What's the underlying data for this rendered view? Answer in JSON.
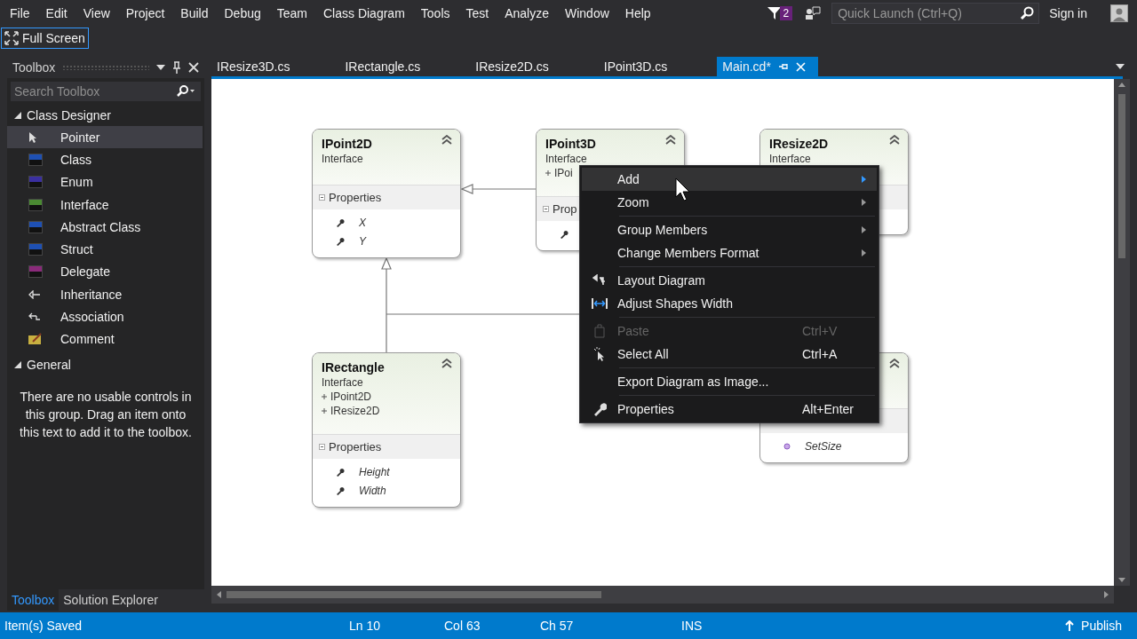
{
  "menu_bar": [
    "File",
    "Edit",
    "View",
    "Project",
    "Build",
    "Debug",
    "Team",
    "Class Diagram",
    "Tools",
    "Test",
    "Analyze",
    "Window",
    "Help"
  ],
  "notifications": {
    "count": "2"
  },
  "quick_launch": {
    "placeholder": "Quick Launch (Ctrl+Q)"
  },
  "sign_in": "Sign in",
  "toolbar": {
    "full_screen": "Full Screen"
  },
  "toolbox": {
    "title": "Toolbox",
    "search_placeholder": "Search Toolbox",
    "groups": [
      {
        "name": "Class Designer",
        "expanded": true,
        "items": [
          {
            "label": "Pointer",
            "kind": "pointer",
            "selected": true
          },
          {
            "label": "Class",
            "kind": "class",
            "selected": false
          },
          {
            "label": "Enum",
            "kind": "enum",
            "selected": false
          },
          {
            "label": "Interface",
            "kind": "interface",
            "selected": false
          },
          {
            "label": "Abstract Class",
            "kind": "abstract",
            "selected": false
          },
          {
            "label": "Struct",
            "kind": "struct",
            "selected": false
          },
          {
            "label": "Delegate",
            "kind": "delegate",
            "selected": false
          },
          {
            "label": "Inheritance",
            "kind": "inheritance",
            "selected": false
          },
          {
            "label": "Association",
            "kind": "association",
            "selected": false
          },
          {
            "label": "Comment",
            "kind": "comment",
            "selected": false
          }
        ]
      },
      {
        "name": "General",
        "expanded": true,
        "message": "There are no usable controls in this group. Drag an item onto this text to add it to the toolbox."
      }
    ]
  },
  "panel_tabs": [
    {
      "label": "Toolbox",
      "selected": true
    },
    {
      "label": "Solution Explorer",
      "selected": false
    }
  ],
  "document_tabs": [
    {
      "label": "IResize3D.cs",
      "selected": false
    },
    {
      "label": "IRectangle.cs",
      "selected": false
    },
    {
      "label": "IResize2D.cs",
      "selected": false
    },
    {
      "label": "IPoint3D.cs",
      "selected": false
    },
    {
      "label": "Main.cd*",
      "selected": true
    }
  ],
  "diagram": {
    "shapes": [
      {
        "title": "IPoint2D",
        "stereotype": "Interface",
        "compartment": "Properties",
        "members": [
          {
            "kind": "property",
            "name": "X"
          },
          {
            "kind": "property",
            "name": "Y"
          }
        ]
      },
      {
        "title": "IPoint3D",
        "stereotype": "Interface",
        "bases": [
          "IPoi"
        ],
        "compartment": "Prop",
        "members": [
          {
            "kind": "property"
          }
        ]
      },
      {
        "title": "IResize2D",
        "stereotype": "Interface"
      },
      {
        "title": "IRectangle",
        "stereotype": "Interface",
        "bases": [
          "IPoint2D",
          "IResize2D"
        ],
        "compartment": "Properties",
        "members": [
          {
            "kind": "property",
            "name": "Height"
          },
          {
            "kind": "property",
            "name": "Width"
          }
        ]
      },
      {
        "members": [
          {
            "kind": "method",
            "name": "SetSize"
          }
        ]
      }
    ]
  },
  "context_menu": [
    {
      "kind": "submenu",
      "label": "Add",
      "highlighted": true,
      "disabled": false
    },
    {
      "kind": "submenu",
      "label": "Zoom",
      "highlighted": false,
      "disabled": false
    },
    {
      "kind": "separator"
    },
    {
      "kind": "submenu",
      "label": "Group Members",
      "highlighted": false,
      "disabled": false
    },
    {
      "kind": "submenu",
      "label": "Change Members Format",
      "highlighted": false,
      "disabled": false
    },
    {
      "kind": "separator"
    },
    {
      "kind": "item",
      "label": "Layout Diagram",
      "highlighted": false,
      "disabled": false
    },
    {
      "kind": "item",
      "label": "Adjust Shapes Width",
      "highlighted": false,
      "disabled": false
    },
    {
      "kind": "separator"
    },
    {
      "kind": "item",
      "label": "Paste",
      "shortcut": "Ctrl+V",
      "highlighted": false,
      "disabled": true
    },
    {
      "kind": "item",
      "label": "Select All",
      "shortcut": "Ctrl+A",
      "highlighted": false,
      "disabled": false
    },
    {
      "kind": "separator"
    },
    {
      "kind": "item",
      "label": "Export Diagram as Image...",
      "highlighted": false,
      "disabled": false
    },
    {
      "kind": "separator"
    },
    {
      "kind": "item",
      "label": "Properties",
      "shortcut": "Alt+Enter",
      "highlighted": false,
      "disabled": false
    }
  ],
  "status_bar": {
    "message": "Item(s) Saved",
    "line": "Ln 10",
    "column": "Col 63",
    "char": "Ch 57",
    "mode": "INS",
    "publish": "Publish"
  }
}
